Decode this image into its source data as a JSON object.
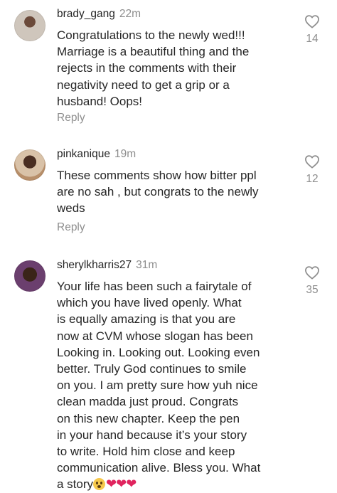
{
  "comments": [
    {
      "username": "brady_gang",
      "time": "22m",
      "lines": [
        "Congratulations to the newly wed!!!",
        "Marriage is a beautiful thing and the",
        "rejects in the comments with their",
        "negativity need to get a grip or a",
        "husband! Oops!"
      ],
      "reply_label": "Reply",
      "likes": "14",
      "avatar_icon": "user-avatar"
    },
    {
      "username": "pinkanique",
      "time": "19m",
      "lines": [
        "These comments show how bitter ppl",
        "are no sah , but congrats to the newly",
        "weds"
      ],
      "reply_label": "Reply",
      "likes": "12",
      "avatar_icon": "user-avatar"
    },
    {
      "username": "sherylkharris27",
      "time": "31m",
      "lines": [
        "Your life has been such a fairytale of",
        "which you have lived openly. What",
        "is equally amazing is that you are",
        "now at CVM whose slogan has been",
        "Looking in. Looking out. Looking even",
        "better. Truly God continues to smile",
        "on you. I am pretty sure how yuh nice",
        "clean madda just proud. Congrats",
        "on this new chapter. Keep the pen",
        "in your hand because it’s your story",
        "to write. Hold him close and keep",
        "communication alive. Bless you. What",
        "a story"
      ],
      "trailing_emoji": "😮❤❤❤",
      "likes": "35",
      "avatar_icon": "user-avatar"
    }
  ],
  "icons": {
    "like": "heart-outline-icon",
    "emoji": "hushed-face-and-red-hearts"
  },
  "colors": {
    "text": "#262626",
    "muted": "#8e8e8e",
    "heart_emoji": "#e0245e"
  }
}
